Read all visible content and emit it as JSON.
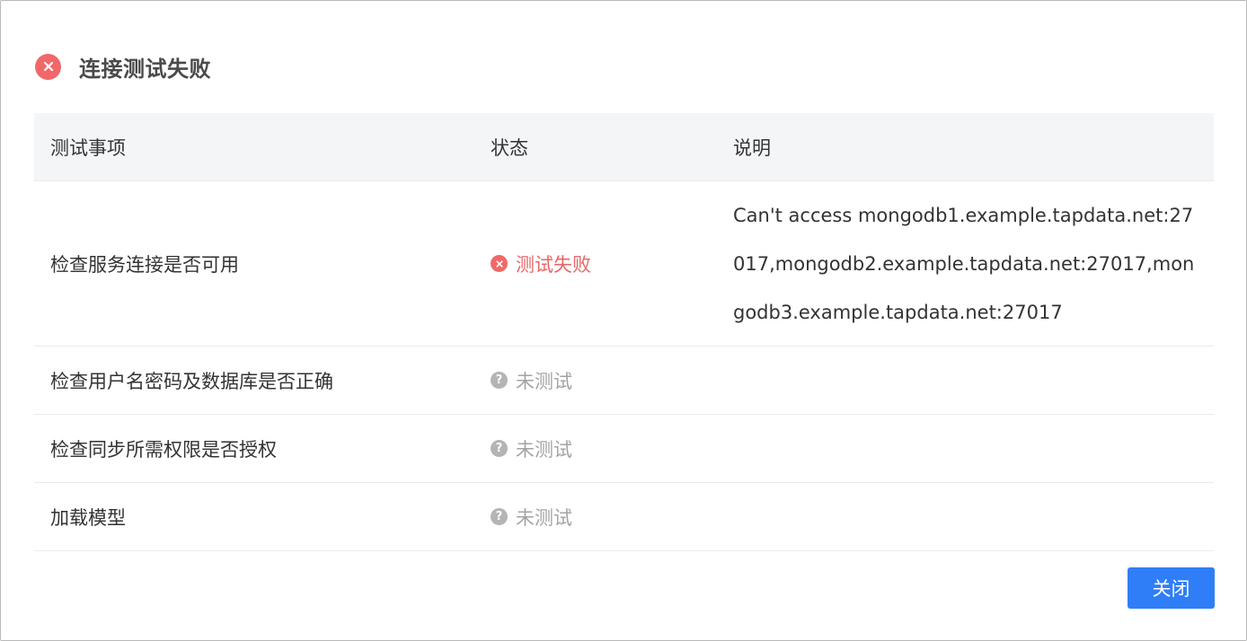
{
  "dialog": {
    "title": "连接测试失败",
    "title_icon": "close-circle-icon",
    "colors": {
      "error": "#f16868",
      "error_text": "#e86666",
      "muted": "#a3a3a3",
      "primary": "#2f7ef8",
      "header_bg": "#f4f5f7"
    }
  },
  "table": {
    "headers": {
      "item": "测试事项",
      "status": "状态",
      "description": "说明"
    },
    "rows": [
      {
        "item": "检查服务连接是否可用",
        "status": "测试失败",
        "status_icon": "close-circle-icon",
        "status_type": "failed",
        "description": "Can't access mongodb1.example.tapdata.net:27017,mongodb2.example.tapdata.net:27017,mongodb3.example.tapdata.net:27017"
      },
      {
        "item": "检查用户名密码及数据库是否正确",
        "status": "未测试",
        "status_icon": "question-circle-icon",
        "status_type": "untested",
        "description": ""
      },
      {
        "item": "检查同步所需权限是否授权",
        "status": "未测试",
        "status_icon": "question-circle-icon",
        "status_type": "untested",
        "description": ""
      },
      {
        "item": "加载模型",
        "status": "未测试",
        "status_icon": "question-circle-icon",
        "status_type": "untested",
        "description": ""
      }
    ]
  },
  "footer": {
    "close_label": "关闭"
  }
}
